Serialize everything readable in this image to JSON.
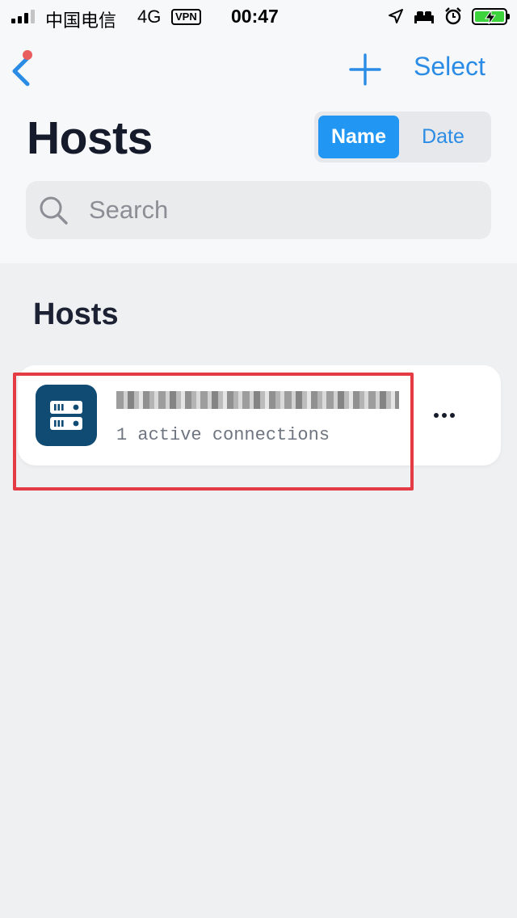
{
  "status_bar": {
    "carrier": "中国电信",
    "network": "4G",
    "vpn": "VPN",
    "time": "00:47",
    "battery_color": "#3cd33c"
  },
  "nav": {
    "back_icon": "chevron-left-icon",
    "add_icon": "plus-icon",
    "select_label": "Select",
    "accent_color": "#2b8ce6"
  },
  "header": {
    "title": "Hosts",
    "sort_options": [
      {
        "label": "Name",
        "active": true
      },
      {
        "label": "Date",
        "active": false
      }
    ]
  },
  "search": {
    "placeholder": "Search",
    "value": ""
  },
  "section": {
    "title": "Hosts"
  },
  "hosts": [
    {
      "name": "",
      "name_obscured": true,
      "status": "1 active connections",
      "icon": "server-icon",
      "icon_color": "#0f4b72",
      "more_icon": "more-horizontal-icon"
    }
  ],
  "annotation": {
    "highlight_color": "#e43b44"
  }
}
